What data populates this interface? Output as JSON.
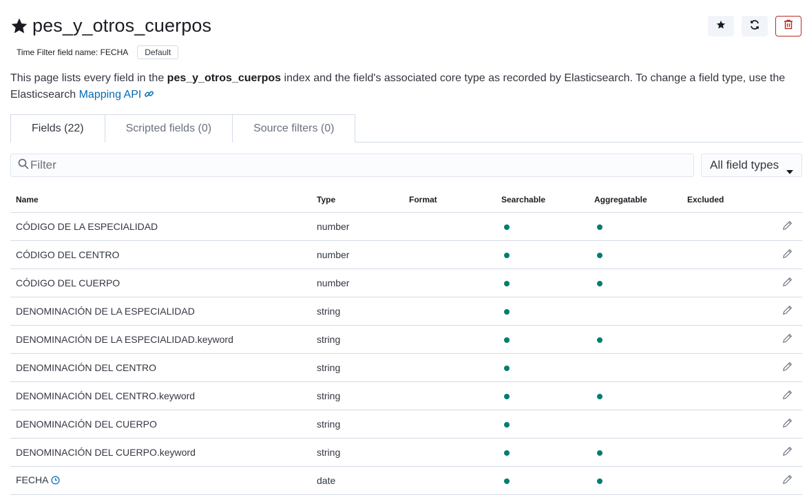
{
  "header": {
    "title": "pes_y_otros_cuerpos",
    "time_filter_label": "Time Filter field name: FECHA",
    "default_badge": "Default"
  },
  "description": {
    "text_before": "This page lists every field in the ",
    "index_name": "pes_y_otros_cuerpos",
    "text_after": " index and the field's associated core type as recorded by Elasticsearch. To change a field type, use the Elasticsearch ",
    "link_text": "Mapping API"
  },
  "tabs": [
    {
      "label": "Fields (22)"
    },
    {
      "label": "Scripted fields (0)"
    },
    {
      "label": "Source filters (0)"
    }
  ],
  "filter": {
    "placeholder": "Filter"
  },
  "type_select": {
    "selected": "All field types"
  },
  "table": {
    "columns": [
      "Name",
      "Type",
      "Format",
      "Searchable",
      "Aggregatable",
      "Excluded"
    ],
    "rows": [
      {
        "name": "CÓDIGO DE LA ESPECIALIDAD",
        "type": "number",
        "searchable": true,
        "aggregatable": true,
        "time_icon": false
      },
      {
        "name": "CÓDIGO DEL CENTRO",
        "type": "number",
        "searchable": true,
        "aggregatable": true,
        "time_icon": false
      },
      {
        "name": "CÓDIGO DEL CUERPO",
        "type": "number",
        "searchable": true,
        "aggregatable": true,
        "time_icon": false
      },
      {
        "name": "DENOMINACIÓN DE LA ESPECIALIDAD",
        "type": "string",
        "searchable": true,
        "aggregatable": false,
        "time_icon": false
      },
      {
        "name": "DENOMINACIÓN DE LA ESPECIALIDAD.keyword",
        "type": "string",
        "searchable": true,
        "aggregatable": true,
        "time_icon": false
      },
      {
        "name": "DENOMINACIÓN DEL CENTRO",
        "type": "string",
        "searchable": true,
        "aggregatable": false,
        "time_icon": false
      },
      {
        "name": "DENOMINACIÓN DEL CENTRO.keyword",
        "type": "string",
        "searchable": true,
        "aggregatable": true,
        "time_icon": false
      },
      {
        "name": "DENOMINACIÓN DEL CUERPO",
        "type": "string",
        "searchable": true,
        "aggregatable": false,
        "time_icon": false
      },
      {
        "name": "DENOMINACIÓN DEL CUERPO.keyword",
        "type": "string",
        "searchable": true,
        "aggregatable": true,
        "time_icon": false
      },
      {
        "name": "FECHA",
        "type": "date",
        "searchable": true,
        "aggregatable": true,
        "time_icon": true
      }
    ]
  },
  "colors": {
    "accent": "#006bb4",
    "dot": "#017d73",
    "danger": "#bd271e"
  },
  "icons": {
    "title": "star-icon",
    "favorite": "star-icon",
    "refresh": "refresh-icon",
    "delete": "trash-icon",
    "link": "link-icon",
    "search": "search-icon",
    "caret": "caret-down-icon",
    "edit": "pencil-icon",
    "time": "clock-icon"
  }
}
